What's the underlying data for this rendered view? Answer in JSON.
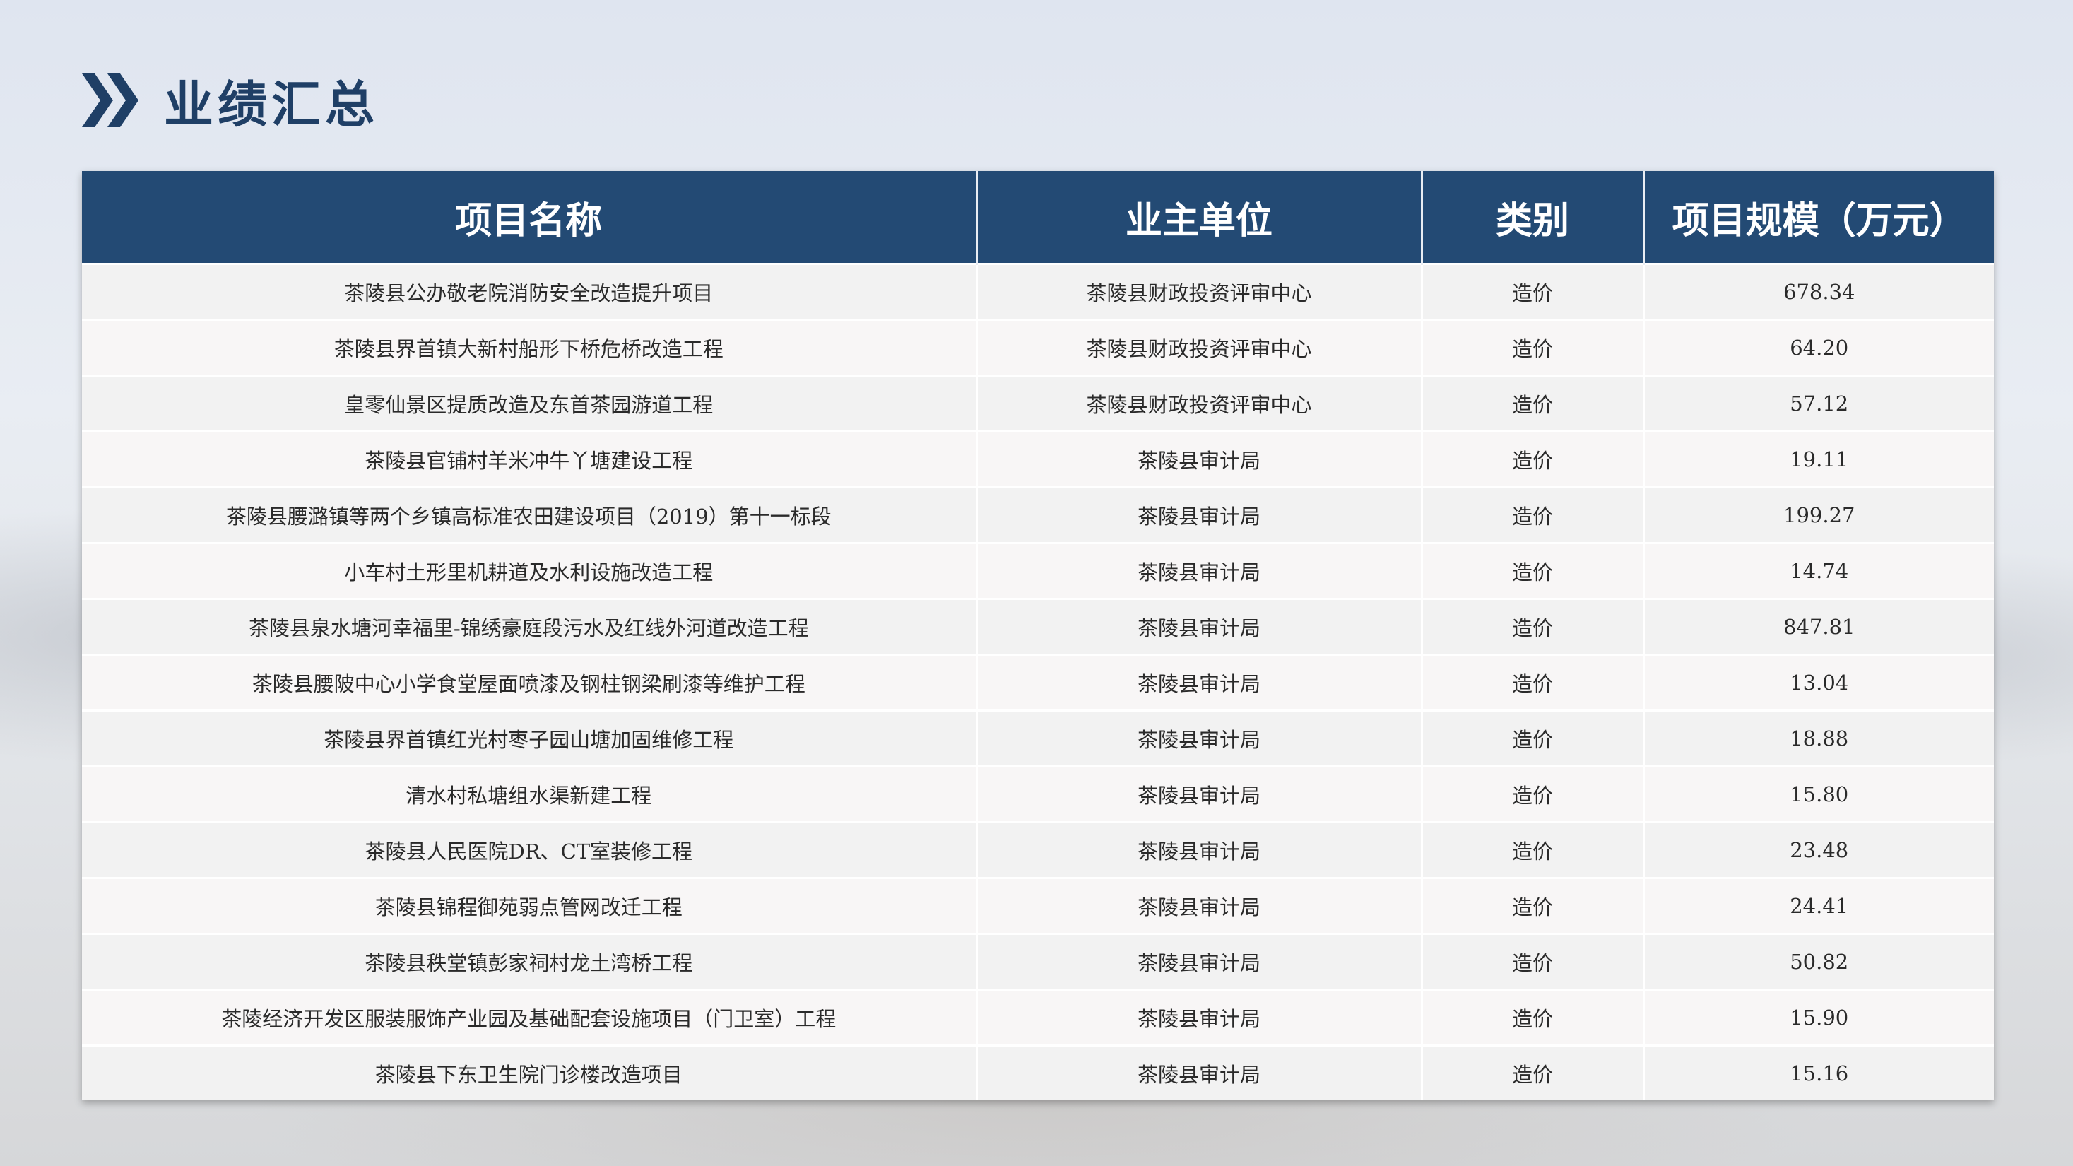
{
  "page": {
    "title": "业绩汇总"
  },
  "table": {
    "headers": [
      "项目名称",
      "业主单位",
      "类别",
      "项目规模（万元）"
    ],
    "rows": [
      [
        "茶陵县公办敬老院消防安全改造提升项目",
        "茶陵县财政投资评审中心",
        "造价",
        "678.34"
      ],
      [
        "茶陵县界首镇大新村船形下桥危桥改造工程",
        "茶陵县财政投资评审中心",
        "造价",
        "64.20"
      ],
      [
        "皇零仙景区提质改造及东首茶园游道工程",
        "茶陵县财政投资评审中心",
        "造价",
        "57.12"
      ],
      [
        "茶陵县官铺村羊米冲牛丫塘建设工程",
        "茶陵县审计局",
        "造价",
        "19.11"
      ],
      [
        "茶陵县腰潞镇等两个乡镇高标准农田建设项目（2019）第十一标段",
        "茶陵县审计局",
        "造价",
        "199.27"
      ],
      [
        "小车村土形里机耕道及水利设施改造工程",
        "茶陵县审计局",
        "造价",
        "14.74"
      ],
      [
        "茶陵县泉水塘河幸福里-锦绣豪庭段污水及红线外河道改造工程",
        "茶陵县审计局",
        "造价",
        "847.81"
      ],
      [
        "茶陵县腰陂中心小学食堂屋面喷漆及钢柱钢梁刷漆等维护工程",
        "茶陵县审计局",
        "造价",
        "13.04"
      ],
      [
        "茶陵县界首镇红光村枣子园山塘加固维修工程",
        "茶陵县审计局",
        "造价",
        "18.88"
      ],
      [
        "清水村私塘组水渠新建工程",
        "茶陵县审计局",
        "造价",
        "15.80"
      ],
      [
        "茶陵县人民医院DR、CT室装修工程",
        "茶陵县审计局",
        "造价",
        "23.48"
      ],
      [
        "茶陵县锦程御苑弱点管网改迁工程",
        "茶陵县审计局",
        "造价",
        "24.41"
      ],
      [
        "茶陵县秩堂镇彭家祠村龙土湾桥工程",
        "茶陵县审计局",
        "造价",
        "50.82"
      ],
      [
        "茶陵经济开发区服装服饰产业园及基础配套设施项目（门卫室）工程",
        "茶陵县审计局",
        "造价",
        "15.90"
      ],
      [
        "茶陵县下东卫生院门诊楼改造项目",
        "茶陵县审计局",
        "造价",
        "15.16"
      ]
    ]
  },
  "icons": {
    "title_icon": "double-chevron-right-icon"
  },
  "colors": {
    "header_bg": "#234a74",
    "title_text": "#1f3f66"
  }
}
